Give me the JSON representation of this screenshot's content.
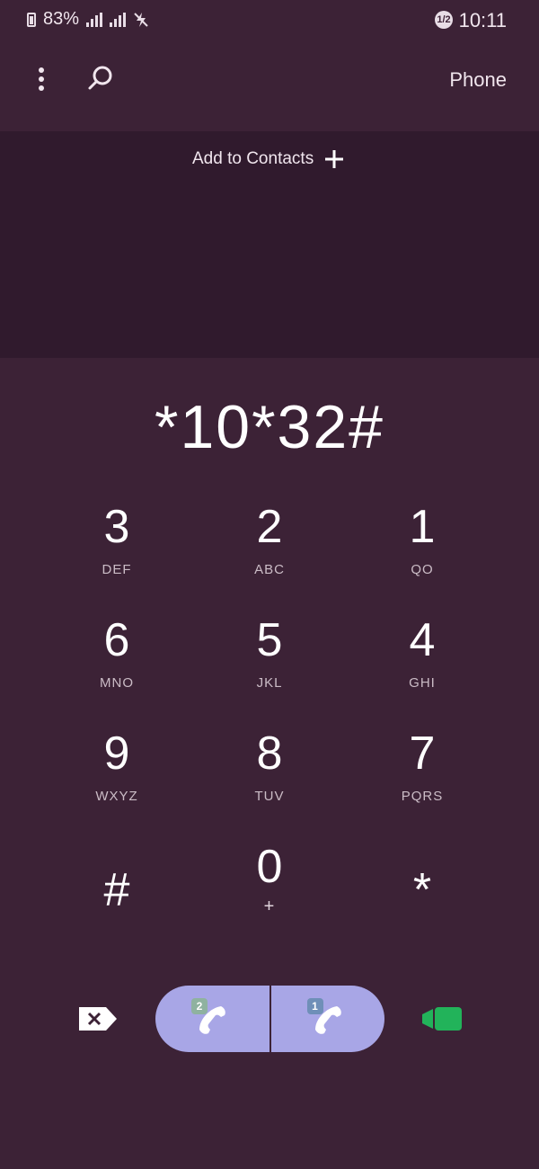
{
  "status_bar": {
    "time": "10:11",
    "sim_indicator": "1/2",
    "battery": "83%",
    "icons": [
      "battery-icon",
      "signal-icon",
      "signal-icon",
      "no-charge-icon"
    ]
  },
  "header": {
    "title": "Phone",
    "icons": [
      "more-options-icon",
      "search-icon"
    ]
  },
  "contacts": {
    "add_label": "Add to Contacts"
  },
  "dialer": {
    "number": "*10*32#"
  },
  "keypad": {
    "keys": [
      {
        "digit": "3",
        "letters": "DEF"
      },
      {
        "digit": "2",
        "letters": "ABC"
      },
      {
        "digit": "1",
        "letters": "QO"
      },
      {
        "digit": "6",
        "letters": "MNO"
      },
      {
        "digit": "5",
        "letters": "JKL"
      },
      {
        "digit": "4",
        "letters": "GHI"
      },
      {
        "digit": "9",
        "letters": "WXYZ"
      },
      {
        "digit": "8",
        "letters": "TUV"
      },
      {
        "digit": "7",
        "letters": "PQRS"
      },
      {
        "digit": "#",
        "letters": ""
      },
      {
        "digit": "0",
        "letters": "+"
      },
      {
        "digit": "*",
        "letters": ""
      }
    ]
  },
  "actions": {
    "sim2_label": "2",
    "sim1_label": "1",
    "colors": {
      "call_pill": "#a8a6e6",
      "video_call": "#22b35a",
      "sim2_badge": "#8fb2a0",
      "sim1_badge": "#6f8fb8"
    },
    "icons": [
      "backspace-icon",
      "sim2-call-icon",
      "sim1-call-icon",
      "video-call-icon"
    ]
  }
}
